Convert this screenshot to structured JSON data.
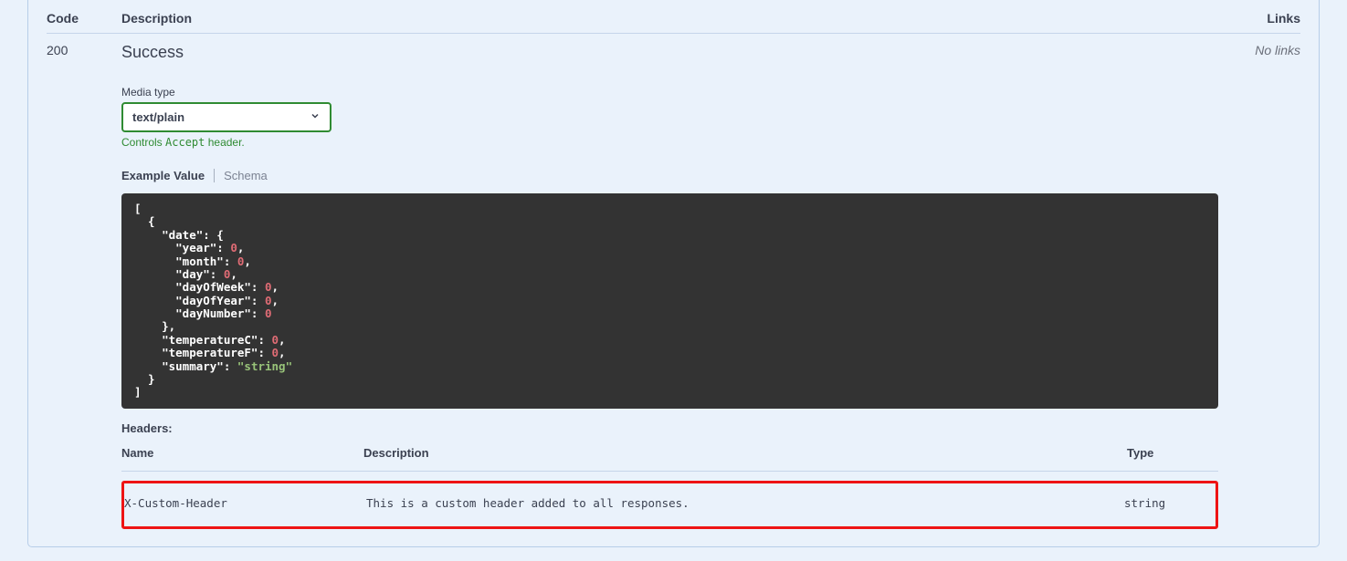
{
  "columns": {
    "code": "Code",
    "description": "Description",
    "links": "Links"
  },
  "response": {
    "code": "200",
    "description": "Success",
    "links": "No links"
  },
  "media": {
    "label": "Media type",
    "selected": "text/plain",
    "hint_prefix": "Controls ",
    "hint_mono": "Accept",
    "hint_suffix": " header."
  },
  "tabs": {
    "example": "Example Value",
    "schema": "Schema"
  },
  "example_json": {
    "line1": "[",
    "line2": "  {",
    "line3": "    \"date\": {",
    "line4": "      \"year\": ",
    "line4v": "0",
    "line4e": ",",
    "line5": "      \"month\": ",
    "line5v": "0",
    "line5e": ",",
    "line6": "      \"day\": ",
    "line6v": "0",
    "line6e": ",",
    "line7": "      \"dayOfWeek\": ",
    "line7v": "0",
    "line7e": ",",
    "line8": "      \"dayOfYear\": ",
    "line8v": "0",
    "line8e": ",",
    "line9": "      \"dayNumber\": ",
    "line9v": "0",
    "line10": "    },",
    "line11": "    \"temperatureC\": ",
    "line11v": "0",
    "line11e": ",",
    "line12": "    \"temperatureF\": ",
    "line12v": "0",
    "line12e": ",",
    "line13": "    \"summary\": ",
    "line13v": "\"string\"",
    "line14": "  }",
    "line15": "]"
  },
  "headers": {
    "label": "Headers:",
    "cols": {
      "name": "Name",
      "description": "Description",
      "type": "Type"
    },
    "row": {
      "name": "X-Custom-Header",
      "description": "This is a custom header added to all responses.",
      "type": "string"
    }
  }
}
